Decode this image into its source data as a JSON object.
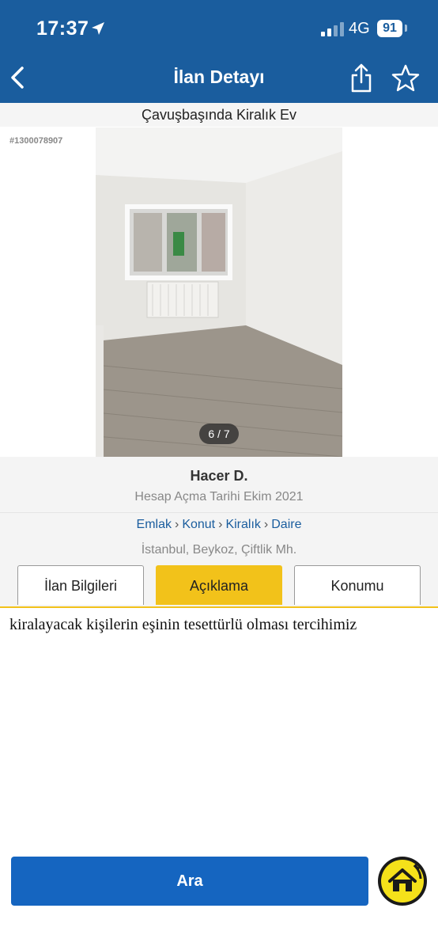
{
  "status_bar": {
    "time": "17:37",
    "network": "4G",
    "battery": "91"
  },
  "nav": {
    "title": "İlan Detayı"
  },
  "listing": {
    "title": "Çavuşbaşında Kiralık Ev",
    "id": "#1300078907",
    "photo_counter": "6 / 7"
  },
  "owner": {
    "name": "Hacer D.",
    "account_date": "Hesap Açma Tarihi  Ekim 2021"
  },
  "breadcrumb": [
    "Emlak",
    "Konut",
    "Kiralık",
    "Daire"
  ],
  "location": "İstanbul, Beykoz, Çiftlik Mh.",
  "tabs": [
    {
      "label": "İlan Bilgileri"
    },
    {
      "label": "Açıklama"
    },
    {
      "label": "Konumu"
    }
  ],
  "active_tab": "Açıklama",
  "description": "kiralayacak kişilerin eşinin tesettürlü olması tercihimiz",
  "call_button": "Ara",
  "colors": {
    "header": "#1a5d9e",
    "accent": "#f2c21a",
    "primary_button": "#1565c0"
  }
}
